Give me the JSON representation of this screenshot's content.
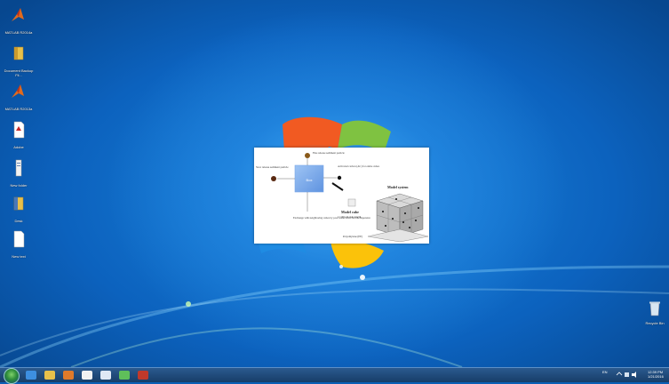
{
  "desktop": {
    "icons": [
      {
        "label": "MATLAB R2014a",
        "icon": "matlab-icon"
      },
      {
        "label": "Document Backup Fil...",
        "icon": "folder-icon"
      },
      {
        "label": "MATLAB R2013a",
        "icon": "matlab-icon"
      },
      {
        "label": "Adobe",
        "icon": "pdf-icon"
      },
      {
        "label": "New folder",
        "icon": "file-icon"
      },
      {
        "label": "Desk",
        "icon": "folder-icon"
      },
      {
        "label": "New text",
        "icon": "file-icon"
      }
    ],
    "recycle_bin": "Recycle Bin"
  },
  "figure": {
    "box_label": "Box",
    "fine_sediment": "Fine release sediment particle",
    "slow_sediment": "Slow release sediment particle",
    "activated_carbon": "Activated carbon (AC) for entire cubes",
    "exchange": "Exchange with neighboring cubes by pore-water advection & dispersion",
    "model_system": "Model system",
    "model_cube": "Model cube",
    "model_cube_sub": "1×100 μm side length",
    "polyethylene": "Polyethylene (PE)"
  },
  "taskbar": {
    "pinned": [
      {
        "name": "ie-icon",
        "color": "#3d8fe0"
      },
      {
        "name": "explorer-icon",
        "color": "#e8c04a"
      },
      {
        "name": "media-player-icon",
        "color": "#e07a2a"
      },
      {
        "name": "document-icon",
        "color": "#f2f2f2"
      },
      {
        "name": "word-icon",
        "color": "#dfe8f5"
      },
      {
        "name": "app-icon",
        "color": "#5fbf5a"
      },
      {
        "name": "matlab-icon",
        "color": "#c0392b"
      }
    ],
    "tray": {
      "lang": "EN",
      "time": "12:39 PM",
      "date": "1/21/2016"
    }
  }
}
